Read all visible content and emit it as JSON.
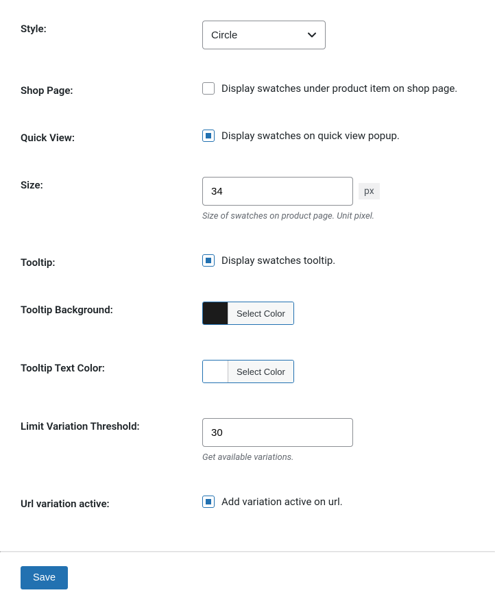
{
  "style": {
    "label": "Style:",
    "value": "Circle"
  },
  "shop_page": {
    "label": "Shop Page:",
    "checkbox_label": "Display swatches under product item on shop page.",
    "checked": false
  },
  "quick_view": {
    "label": "Quick View:",
    "checkbox_label": "Display swatches on quick view popup.",
    "checked": true
  },
  "size": {
    "label": "Size:",
    "value": "34",
    "unit": "px",
    "help": "Size of swatches on product page. Unit pixel."
  },
  "tooltip": {
    "label": "Tooltip:",
    "checkbox_label": "Display swatches tooltip.",
    "checked": true
  },
  "tooltip_bg": {
    "label": "Tooltip Background:",
    "button": "Select Color",
    "color": "#1b1b1b"
  },
  "tooltip_text": {
    "label": "Tooltip Text Color:",
    "button": "Select Color",
    "color": "#ffffff"
  },
  "limit_threshold": {
    "label": "Limit Variation Threshold:",
    "value": "30",
    "help": "Get available variations."
  },
  "url_variation": {
    "label": "Url variation active:",
    "checkbox_label": "Add variation active on url.",
    "checked": true
  },
  "save_button": "Save"
}
